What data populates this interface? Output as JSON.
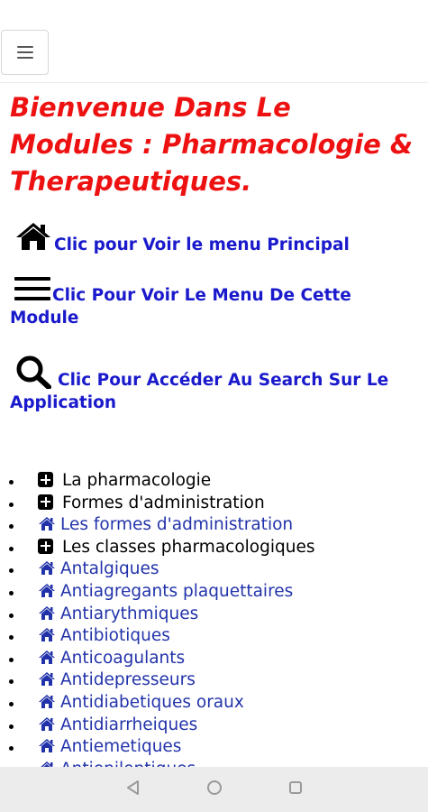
{
  "header": {
    "menu_icon": "hamburger-menu-icon"
  },
  "welcome": {
    "title": "Bienvenue Dans Le Modules : Pharmacologie & Therapeutiques."
  },
  "links": {
    "main_menu": {
      "icon": "home-icon",
      "label": "Clic pour Voir le menu Principal"
    },
    "module_menu": {
      "icon": "menu-bars-icon",
      "label": "Clic Pour Voir Le Menu De Cette Module"
    },
    "search": {
      "icon": "search-icon",
      "label": "Clic Pour Accéder Au Search Sur Le Application"
    }
  },
  "toc": {
    "items": [
      {
        "type": "section",
        "icon": "plus-square-icon",
        "label": "La pharmacologie"
      },
      {
        "type": "section",
        "icon": "plus-square-icon",
        "label": "Formes d'administration"
      },
      {
        "type": "link",
        "icon": "home-icon",
        "label": "Les formes d'administration"
      },
      {
        "type": "section",
        "icon": "plus-square-icon",
        "label": "Les classes pharmacologiques"
      },
      {
        "type": "link",
        "icon": "home-icon",
        "label": "Antalgiques"
      },
      {
        "type": "link",
        "icon": "home-icon",
        "label": "Antiagregants plaquettaires"
      },
      {
        "type": "link",
        "icon": "home-icon",
        "label": "Antiarythmiques"
      },
      {
        "type": "link",
        "icon": "home-icon",
        "label": "Antibiotiques"
      },
      {
        "type": "link",
        "icon": "home-icon",
        "label": "Anticoagulants"
      },
      {
        "type": "link",
        "icon": "home-icon",
        "label": "Antidepresseurs"
      },
      {
        "type": "link",
        "icon": "home-icon",
        "label": "Antidiabetiques oraux"
      },
      {
        "type": "link",
        "icon": "home-icon",
        "label": "Antidiarrheiques"
      },
      {
        "type": "link",
        "icon": "home-icon",
        "label": "Antiemetiques"
      },
      {
        "type": "link",
        "icon": "home-icon",
        "label": "Antiepileptiques"
      }
    ]
  },
  "system_nav": {
    "back_icon": "back-triangle-icon",
    "home_icon": "home-circle-icon",
    "recents_icon": "recents-square-icon"
  },
  "colors": {
    "title": "#ee1111",
    "link": "#1a1acc",
    "list_link": "#2233aa",
    "nav_bar": "#ececec"
  }
}
